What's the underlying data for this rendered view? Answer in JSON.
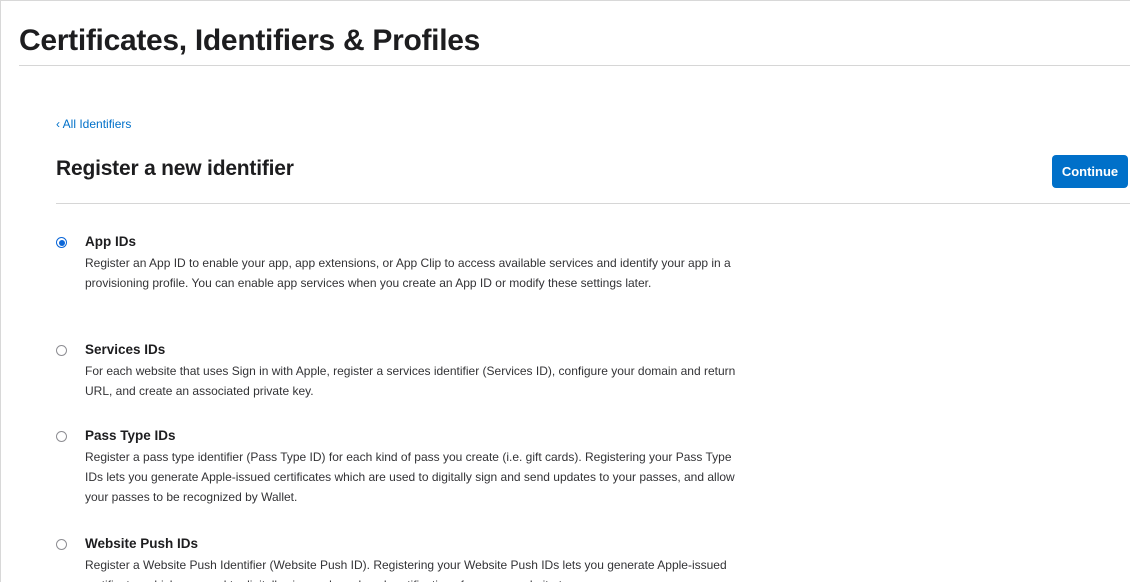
{
  "header": {
    "title": "Certificates, Identifiers & Profiles"
  },
  "nav": {
    "back_link": "‹ All Identifiers"
  },
  "main": {
    "heading": "Register a new identifier",
    "continue_label": "Continue",
    "accent_color": "#0070c9",
    "options": [
      {
        "title": "App IDs",
        "description": "Register an App ID to enable your app, app extensions, or App Clip to access available services and identify your app in a provisioning profile. You can enable app services when you create an App ID or modify these settings later.",
        "selected": true
      },
      {
        "title": "Services IDs",
        "description": "For each website that uses Sign in with Apple, register a services identifier (Services ID), configure your domain and return URL, and create an associated private key.",
        "selected": false
      },
      {
        "title": "Pass Type IDs",
        "description": "Register a pass type identifier (Pass Type ID) for each kind of pass you create (i.e. gift cards). Registering your Pass Type IDs lets you generate Apple-issued certificates which are used to digitally sign and send updates to your passes, and allow your passes to be recognized by Wallet.",
        "selected": false
      },
      {
        "title": "Website Push IDs",
        "description": "Register a Website Push Identifier (Website Push ID). Registering your Website Push IDs lets you generate Apple-issued certificates which are used to digitally sign and send push notifications from your website to",
        "selected": false
      }
    ]
  }
}
